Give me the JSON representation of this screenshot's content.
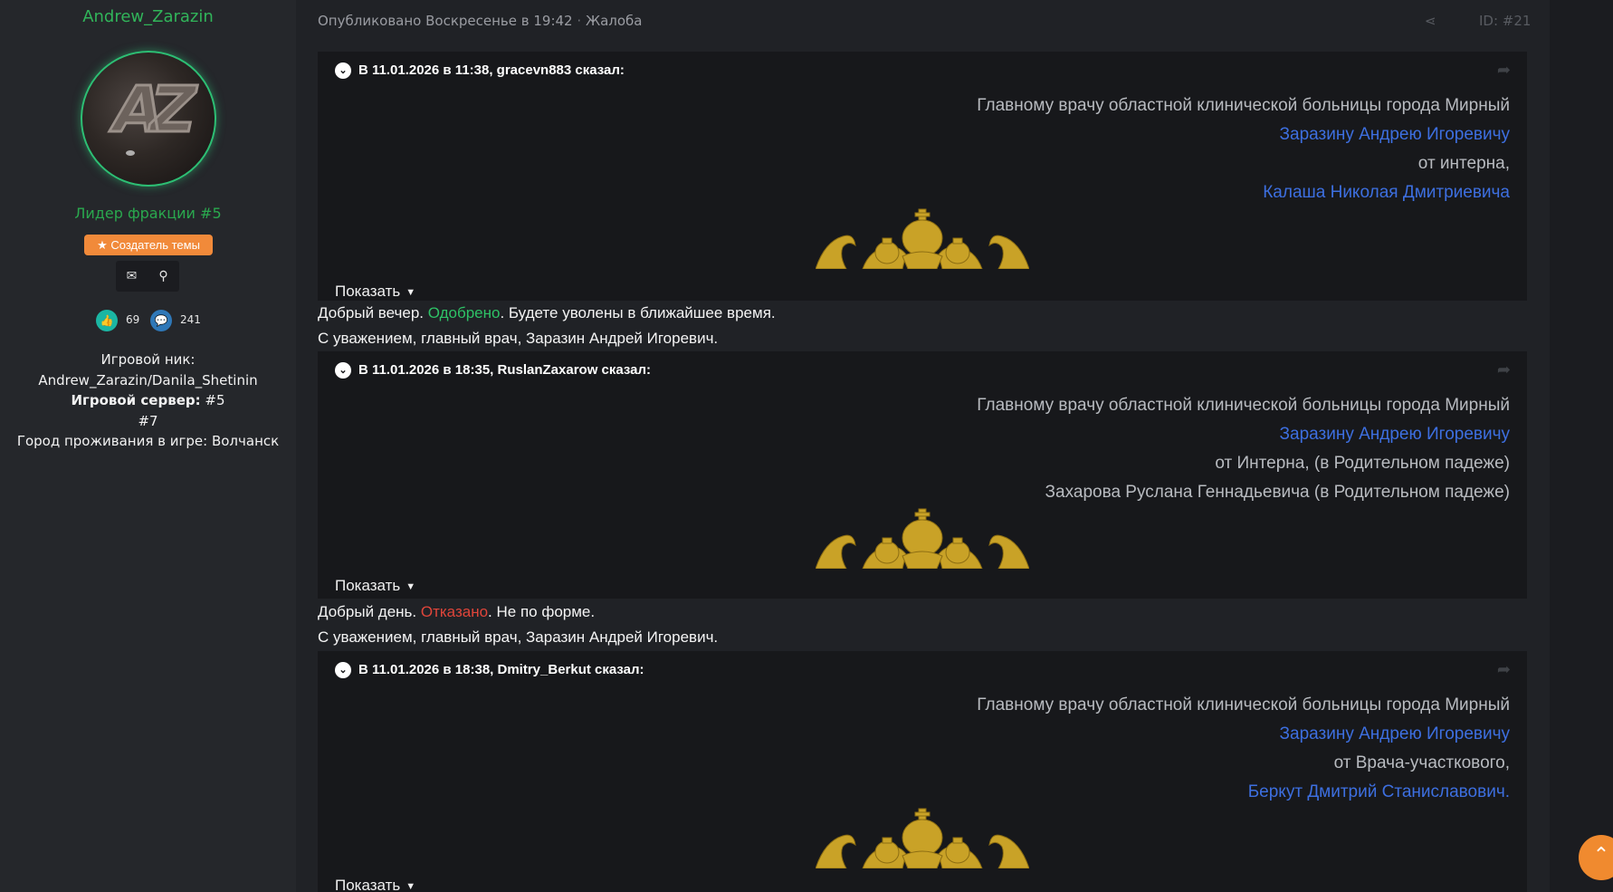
{
  "author": {
    "username": "Andrew_Zarazin",
    "avatar_letters": "AZ",
    "faction": "Лидер фракции #5",
    "badge_icon": "star-icon",
    "badge_label": "Создатель темы",
    "actions": [
      {
        "icon": "envelope-icon",
        "glyph": "✉"
      },
      {
        "icon": "search-icon",
        "glyph": "⚲"
      }
    ],
    "likes": "69",
    "messages": "241",
    "info": {
      "nick_label": "Игровой ник:",
      "nick_value": "Andrew_Zarazin/Danila_Shetinin",
      "server_label": "Игровой сервер:",
      "server_value": "#5",
      "server_extra": "#7",
      "city_label": "Город проживания в игре:",
      "city_value": "Волчанск"
    },
    "colors": {
      "name": "#31b45a",
      "badge": "#f18a3a",
      "likes": "#1bb6a3",
      "messages": "#2f78b8"
    }
  },
  "post": {
    "published": "Опубликовано Воскресенье в 19:42",
    "separator": "·",
    "category": "Жалоба",
    "post_id": "ID: #21",
    "share_icon": "share-icon"
  },
  "quotes": [
    {
      "header": "В 11.01.2026 в 11:38, gracevn883 сказал:",
      "lines": [
        {
          "text": "Главному врачу областной клинической больницы города Мирный",
          "tone": "gray"
        },
        {
          "text": "Заразину Андрею Игоревичу",
          "tone": "blue"
        },
        {
          "text": "от интерна,",
          "tone": "gray"
        },
        {
          "text": "Калаша Николая Дмитриевича",
          "tone": "blue"
        }
      ],
      "show_label": "Показать",
      "reply": {
        "pre": "Добрый вечер. ",
        "status": "Одобрено",
        "post": ". Будете уволены в ближайшее время.",
        "sign": "С уважением, главный врач, Заразин Андрей Игоревич."
      }
    },
    {
      "header": "В 11.01.2026 в 18:35, RuslanZaxarow сказал:",
      "lines": [
        {
          "text": "Главному врачу областной клинической больницы города Мирный",
          "tone": "gray"
        },
        {
          "text": "Заразину Андрею Игоревичу",
          "tone": "blue"
        },
        {
          "text": "от Интерна, (в Родительном падеже)",
          "tone": "gray"
        },
        {
          "text": "Захарова Руслана Геннадьевича (в Родительном падеже)",
          "tone": "gray"
        }
      ],
      "show_label": "Показать",
      "reply": {
        "pre": "Добрый день. ",
        "status": "Отказано",
        "post": ". Не по форме.",
        "sign": "С уважением, главный врач, Заразин Андрей Игоревич."
      }
    },
    {
      "header": "В 11.01.2026 в 18:38, Dmitry_Berkut сказал:",
      "lines": [
        {
          "text": "Главному врачу областной клинической больницы города Мирный",
          "tone": "gray"
        },
        {
          "text": "Заразину Андрею Игоревичу",
          "tone": "blue"
        },
        {
          "text": "от Врача-участкового,",
          "tone": "gray"
        },
        {
          "text": "Беркут Дмитрий Станиславович.",
          "tone": "blue"
        }
      ],
      "show_label": "Показать"
    }
  ],
  "icons": {
    "reply": "reply-arrow-icon",
    "expand": "chevron-down-icon",
    "scroll_top": "chevron-up-icon"
  }
}
